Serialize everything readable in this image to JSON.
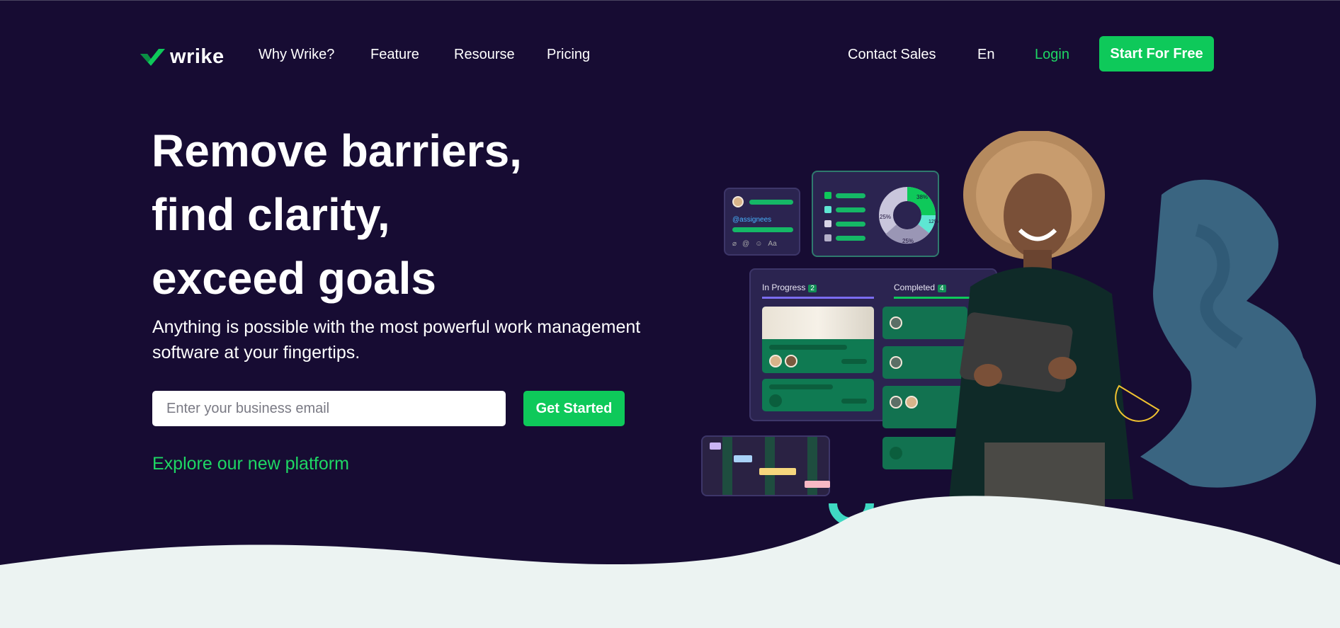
{
  "brand": {
    "name": "wrike",
    "accent": "#0ec95a",
    "background": "#170c33"
  },
  "nav": {
    "links": [
      "Why Wrike?",
      "Feature",
      "Resourse",
      "Pricing"
    ],
    "contact_sales": "Contact Sales",
    "language": "En",
    "login": "Login",
    "cta": "Start For Free"
  },
  "hero": {
    "title_lines": [
      "Remove barriers,",
      "find clarity,",
      "exceed goals"
    ],
    "subtitle": "Anything is possible with the most powerful work management software at your fingertips.",
    "email_placeholder": "Enter your business email",
    "cta": "Get Started",
    "explore_link": "Explore our new platform"
  },
  "illustration": {
    "mention": "@assignees",
    "pie_labels": [
      "38%",
      "12%",
      "25%",
      "25%"
    ],
    "board_columns": [
      {
        "label": "In Progress",
        "count": "2"
      },
      {
        "label": "Completed",
        "count": "4"
      }
    ],
    "toolbar_icons": [
      "attach-icon",
      "mention-icon",
      "emoji-icon",
      "text-format-icon"
    ],
    "toolbar_aa": "Aa"
  }
}
